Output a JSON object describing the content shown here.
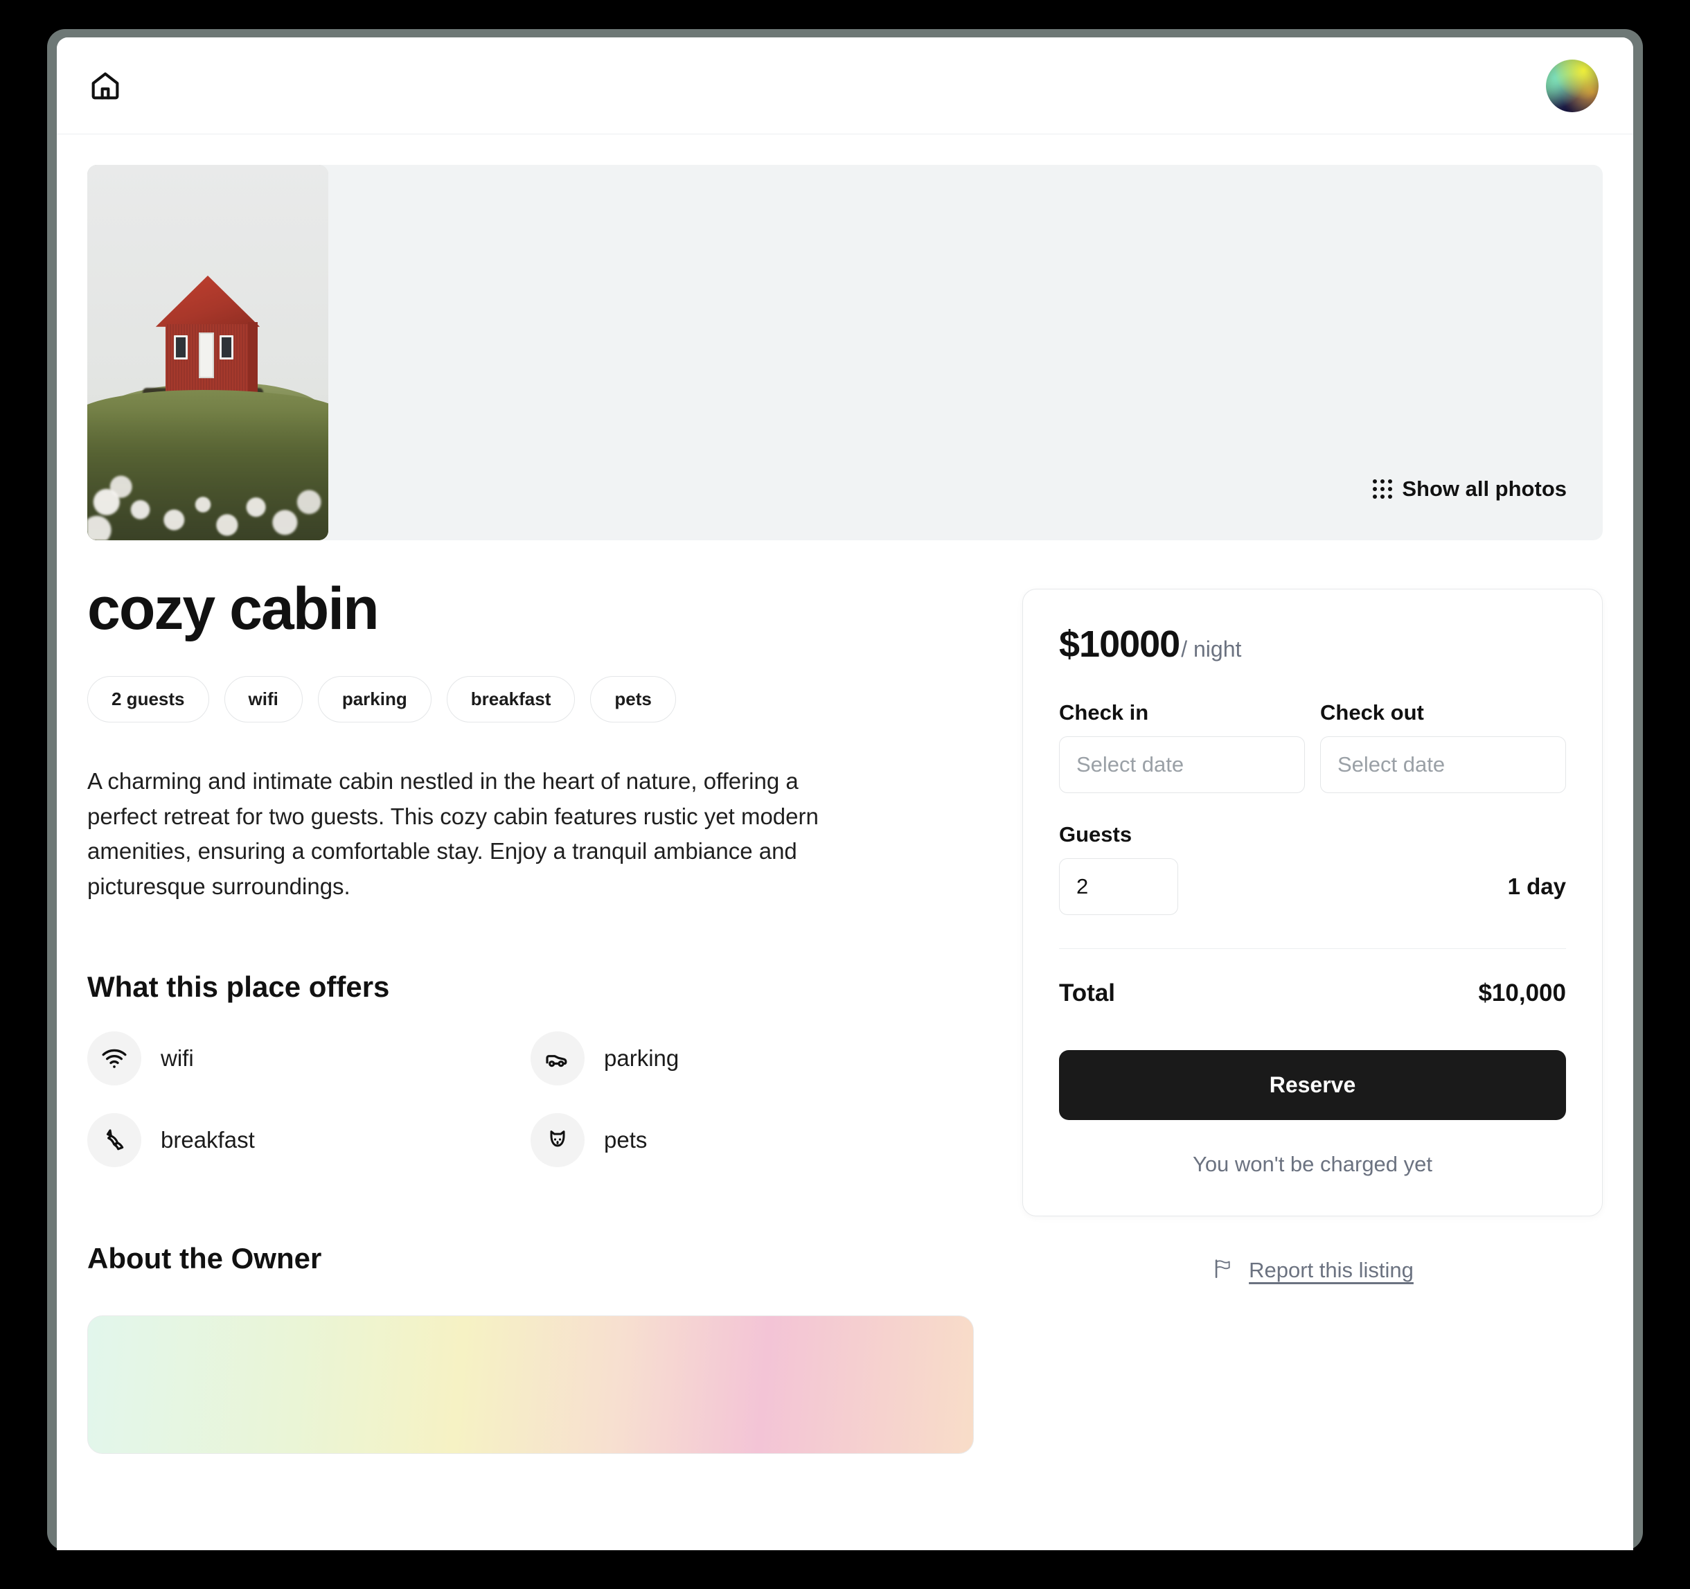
{
  "header": {
    "home_icon": "home-icon",
    "avatar_icon": "avatar-gradient"
  },
  "gallery": {
    "show_all_photos_label": "Show all photos",
    "grid_icon": "grid-dots-icon",
    "photo_alt": "red cabin on grassy hill with white flowers"
  },
  "listing": {
    "title": "cozy cabin",
    "tags": [
      "2 guests",
      "wifi",
      "parking",
      "breakfast",
      "pets"
    ],
    "description": "A charming and intimate cabin nestled in the heart of nature, offering a perfect retreat for two guests. This cozy cabin features rustic yet modern amenities, ensuring a comfortable stay. Enjoy a tranquil ambiance and picturesque surroundings."
  },
  "offers": {
    "heading": "What this place offers",
    "items": [
      {
        "label": "wifi",
        "icon": "wifi-icon"
      },
      {
        "label": "parking",
        "icon": "car-icon"
      },
      {
        "label": "breakfast",
        "icon": "croissant-icon"
      },
      {
        "label": "pets",
        "icon": "dog-icon"
      }
    ]
  },
  "owner": {
    "heading": "About the Owner"
  },
  "booking": {
    "price": "$10000",
    "price_unit": "/ night",
    "check_in_label": "Check in",
    "check_in_value": "",
    "check_in_placeholder": "Select date",
    "check_out_label": "Check out",
    "check_out_value": "",
    "check_out_placeholder": "Select date",
    "guests_label": "Guests",
    "guests_value": "2",
    "nights_text": "1 day",
    "total_label": "Total",
    "total_value": "$10,000",
    "reserve_label": "Reserve",
    "charge_note": "You won't be charged yet",
    "report_label": "Report this listing",
    "report_icon": "flag-icon"
  },
  "colors": {
    "accent_dark": "#1a1a1a",
    "muted_text": "#6b7280",
    "border": "#e4e6e8",
    "gallery_bg": "#f1f3f4",
    "window_frame": "#6e7876"
  }
}
